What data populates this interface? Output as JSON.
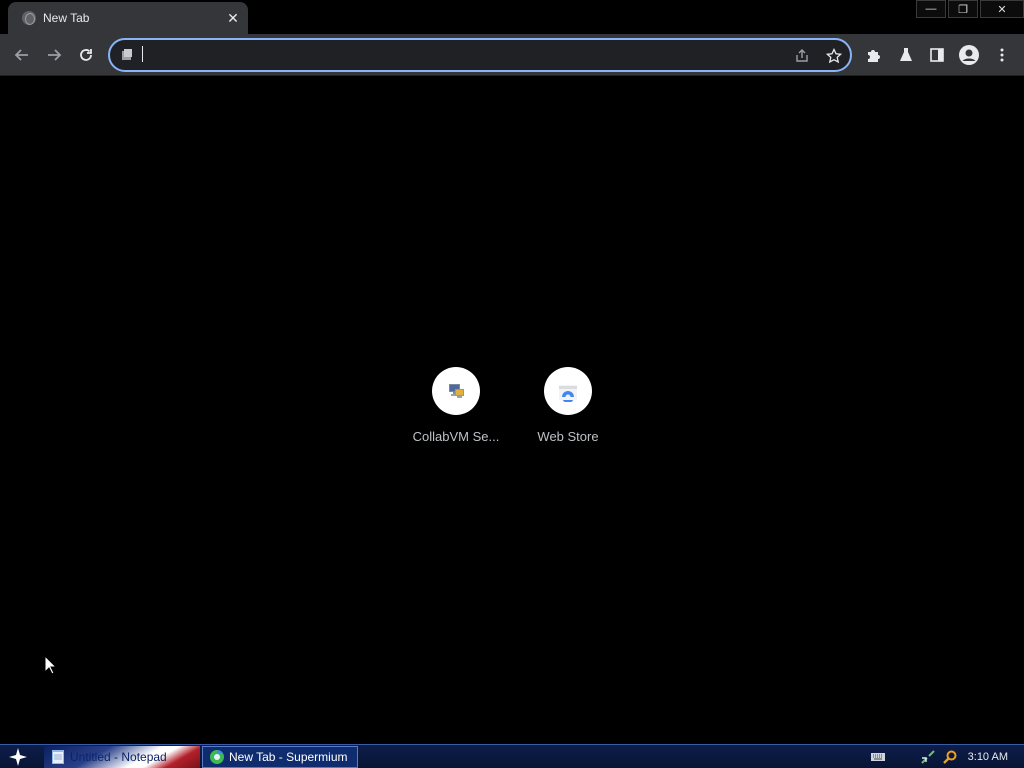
{
  "tab": {
    "title": "New Tab",
    "close_label": "✕"
  },
  "window_controls": {
    "minimize": "—",
    "restore": "❐",
    "close": "✕"
  },
  "omnibox": {
    "value": "",
    "placeholder": ""
  },
  "shortcuts": [
    {
      "label": "CollabVM Se...",
      "icon": "collabvm-icon"
    },
    {
      "label": "Web Store",
      "icon": "web-store-icon"
    }
  ],
  "taskbar": {
    "items": [
      {
        "label": "Untitled - Notepad",
        "icon": "notepad-icon"
      },
      {
        "label": "New Tab - Supermium",
        "icon": "supermium-icon"
      }
    ],
    "clock": "3:10 AM"
  },
  "colors": {
    "accent": "#8ab4f8",
    "toolbar": "#35363a",
    "page_background": "#000000",
    "taskbar": "#0e1e4a"
  }
}
